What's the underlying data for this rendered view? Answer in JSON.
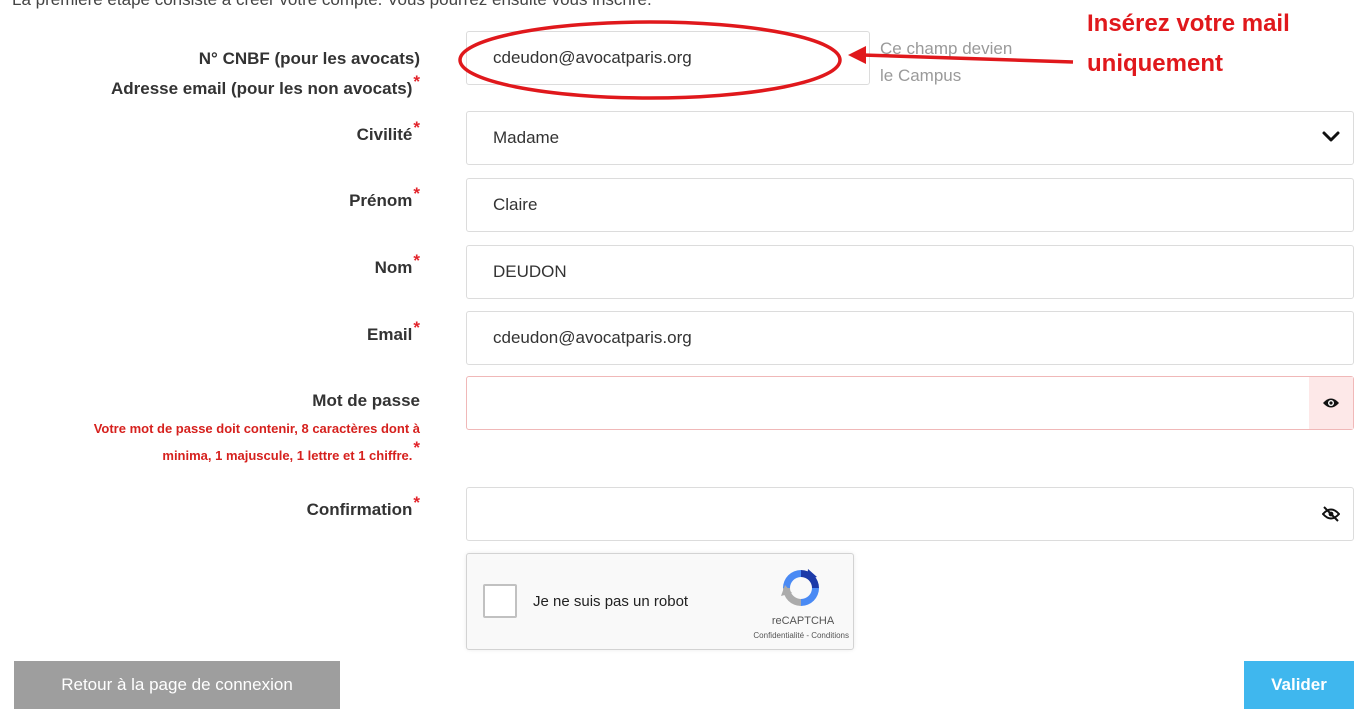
{
  "intro": "La première étape consiste à créer votre compte. Vous pourrez ensuite vous inscrire.",
  "form": {
    "cnbf": {
      "label_line1": "N° CNBF (pour les avocats)",
      "label_line2": "Adresse email (pour les non avocats)",
      "value": "cdeudon@avocatparis.org",
      "hint_line1": "Ce champ devien",
      "hint_line2": "le Campus"
    },
    "civilite": {
      "label": "Civilité",
      "value": "Madame"
    },
    "prenom": {
      "label": "Prénom",
      "value": "Claire"
    },
    "nom": {
      "label": "Nom",
      "value": "DEUDON"
    },
    "email": {
      "label": "Email",
      "value": "cdeudon@avocatparis.org"
    },
    "password": {
      "label": "Mot de passe",
      "value": "",
      "help_line1": "Votre mot de passe doit contenir, 8 caractères dont à",
      "help_line2": "minima, 1 majuscule, 1 lettre et 1 chiffre."
    },
    "confirmation": {
      "label": "Confirmation",
      "value": ""
    },
    "required_mark": "*"
  },
  "recaptcha": {
    "label": "Je ne suis pas un robot",
    "brand": "reCAPTCHA",
    "links": "Confidentialité - Conditions"
  },
  "buttons": {
    "back": "Retour à la page de connexion",
    "submit": "Valider"
  },
  "annotation": {
    "line1": "Insérez votre mail",
    "line2": "uniquement",
    "color": "#e0181c"
  },
  "colors": {
    "submit_button": "#3fb7ee",
    "back_button": "#9e9e9e",
    "required": "#e2232a"
  }
}
